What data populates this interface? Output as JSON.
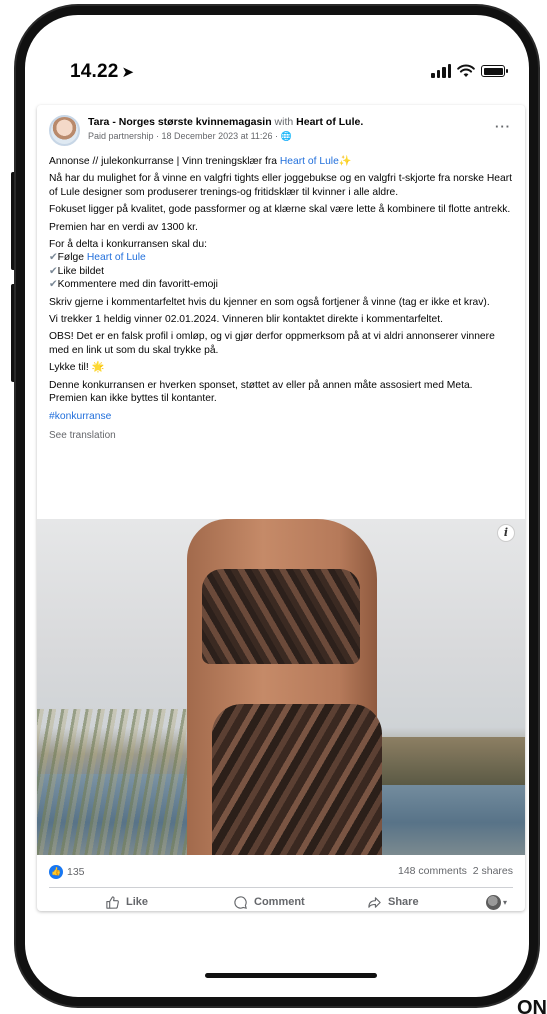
{
  "status_bar": {
    "time": "14.22",
    "location_arrow": "➤"
  },
  "post": {
    "page_name": "Tara - Norges største kvinnemagasin",
    "with_text": "with",
    "partner_name": "Heart of Lule.",
    "meta": "Paid partnership · 18 December 2023 at 11:26 · 🌐",
    "more": "···",
    "title_prefix": "Annonse // julekonkurranse | Vinn treningsklær fra ",
    "title_link": "Heart of Lule",
    "title_suffix": "✨",
    "p1": "Nå har du mulighet for å vinne en valgfri tights eller joggebukse og en valgfri t-skjorte fra norske Heart of Lule designer som produserer trenings-og fritidsklær til kvinner i alle aldre.",
    "p2": "Fokuset ligger på kvalitet, gode passformer og at klærne skal være lette å kombinere til flotte antrekk.",
    "p3": "Premien har en verdi av 1300 kr.",
    "p4_intro": "For å delta i konkurransen skal du:",
    "step1_prefix": "Følge ",
    "step1_link": "Heart of Lule",
    "step2": "Like bildet",
    "step3": "Kommentere med din favoritt-emoji",
    "check": "✔",
    "p5": "Skriv gjerne i kommentarfeltet hvis du kjenner en som også fortjener å vinne (tag er ikke et krav).",
    "p6": "Vi trekker 1 heldig vinner 02.01.2024. Vinneren blir kontaktet direkte i kommentarfeltet.",
    "p7": "OBS! Det er en falsk profil i omløp, og vi gjør derfor oppmerksom på at vi aldri annonserer vinnere med en link ut som du skal trykke på.",
    "p8_text": "Lykke til! ",
    "p8_emoji": "🌟",
    "p9": "Denne konkurransen er hverken sponset, støttet av eller på annen måte assosiert med Meta. Premien kan ikke byttes til kontanter.",
    "hashtag": "#konkurranse",
    "see_translation": "See translation",
    "info": "i"
  },
  "engagement": {
    "reaction_count": "135",
    "comments": "148 comments",
    "shares": "2 shares",
    "like_label": "Like",
    "comment_label": "Comment",
    "share_label": "Share"
  },
  "colors": {
    "link": "#216fdb",
    "like_blue": "#1877f2",
    "muted": "#65676b"
  },
  "corner_text": "ON"
}
